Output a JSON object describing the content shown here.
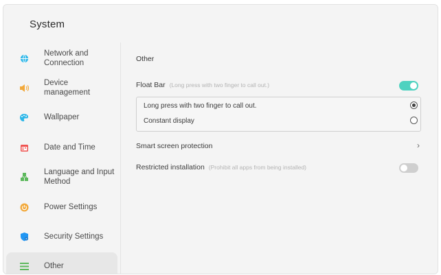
{
  "window": {
    "title": "System"
  },
  "sidebar": {
    "items": [
      {
        "label": "Network and Connection",
        "icon": "globe-icon",
        "color": "#2bb6e8"
      },
      {
        "label": "Device management",
        "icon": "speaker-icon",
        "color": "#f2a93b"
      },
      {
        "label": "Wallpaper",
        "icon": "palette-icon",
        "color": "#2bb6e8"
      },
      {
        "label": "Date and Time",
        "icon": "calendar-icon",
        "color": "#ef5350"
      },
      {
        "label": "Language and Input Method",
        "icon": "language-icon",
        "color": "#5cb85c"
      },
      {
        "label": "Power Settings",
        "icon": "power-icon",
        "color": "#f2a93b"
      },
      {
        "label": "Security Settings",
        "icon": "shield-icon",
        "color": "#2196f3"
      },
      {
        "label": "Other",
        "icon": "list-icon",
        "color": "#5cb85c",
        "active": true
      }
    ]
  },
  "content": {
    "section_title": "Other",
    "float_bar": {
      "label": "Float Bar",
      "hint": "(Long press with two finger to call out.)",
      "enabled": true,
      "options": [
        {
          "label": "Long press with two finger to call out.",
          "selected": true
        },
        {
          "label": "Constant display",
          "selected": false
        }
      ]
    },
    "smart_screen_protection": {
      "label": "Smart screen protection"
    },
    "restricted_installation": {
      "label": "Restricted installation",
      "hint": "(Prohibit all apps from being installed)",
      "enabled": false
    }
  },
  "colors": {
    "accent": "#4ed2c0",
    "toggle_off": "#cfcfcf"
  }
}
